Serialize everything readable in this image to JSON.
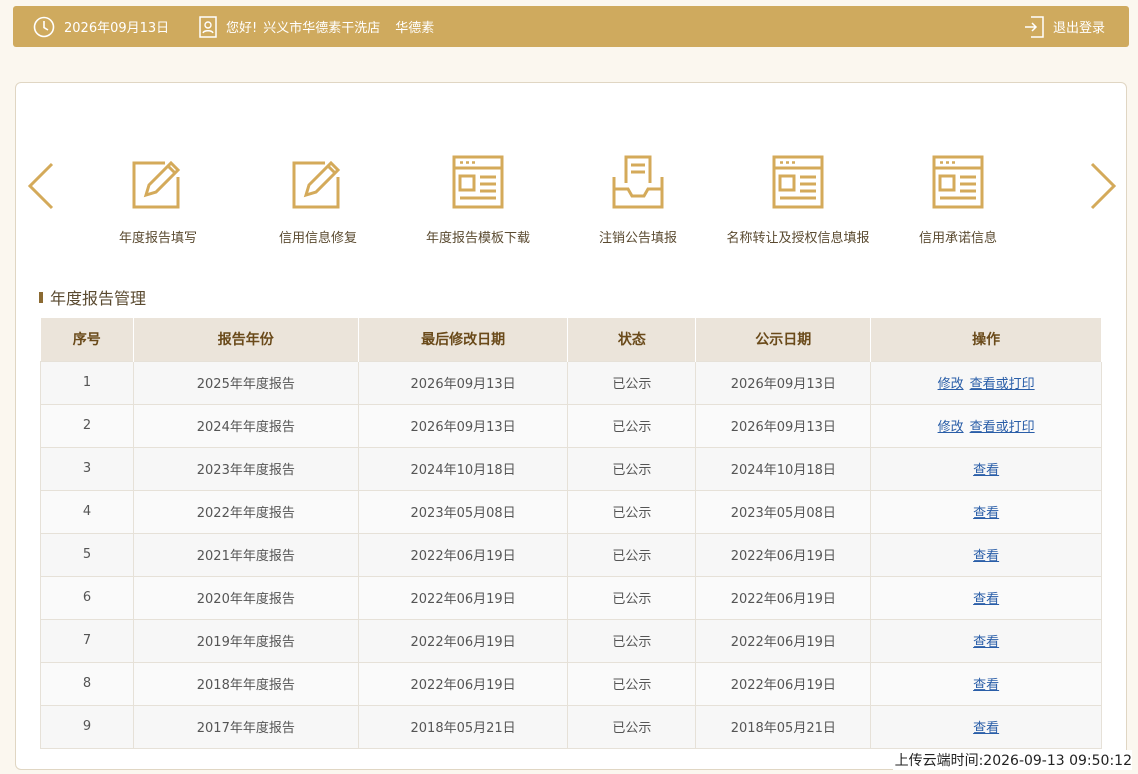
{
  "header": {
    "date": "2026年09月13日",
    "greeting": "您好!",
    "shop_name": "兴义市华德素干洗店",
    "user_name": "华德素",
    "logout_label": "退出登录"
  },
  "functions": [
    {
      "label": "年度报告填写",
      "icon": "edit-icon"
    },
    {
      "label": "信用信息修复",
      "icon": "edit-icon"
    },
    {
      "label": "年度报告模板下载",
      "icon": "document-icon"
    },
    {
      "label": "注销公告填报",
      "icon": "inbox-icon"
    },
    {
      "label": "名称转让及授权信息填报",
      "icon": "document-icon"
    },
    {
      "label": "信用承诺信息",
      "icon": "document-icon"
    }
  ],
  "section_title": "年度报告管理",
  "table": {
    "headers": [
      "序号",
      "报告年份",
      "最后修改日期",
      "状态",
      "公示日期",
      "操作"
    ],
    "rows": [
      {
        "no": "1",
        "year": "2025年年度报告",
        "modified": "2026年09月13日",
        "status": "已公示",
        "published": "2026年09月13日",
        "actions": [
          "修改",
          "查看或打印"
        ]
      },
      {
        "no": "2",
        "year": "2024年年度报告",
        "modified": "2026年09月13日",
        "status": "已公示",
        "published": "2026年09月13日",
        "actions": [
          "修改",
          "查看或打印"
        ]
      },
      {
        "no": "3",
        "year": "2023年年度报告",
        "modified": "2024年10月18日",
        "status": "已公示",
        "published": "2024年10月18日",
        "actions": [
          "查看"
        ]
      },
      {
        "no": "4",
        "year": "2022年年度报告",
        "modified": "2023年05月08日",
        "status": "已公示",
        "published": "2023年05月08日",
        "actions": [
          "查看"
        ]
      },
      {
        "no": "5",
        "year": "2021年年度报告",
        "modified": "2022年06月19日",
        "status": "已公示",
        "published": "2022年06月19日",
        "actions": [
          "查看"
        ]
      },
      {
        "no": "6",
        "year": "2020年年度报告",
        "modified": "2022年06月19日",
        "status": "已公示",
        "published": "2022年06月19日",
        "actions": [
          "查看"
        ]
      },
      {
        "no": "7",
        "year": "2019年年度报告",
        "modified": "2022年06月19日",
        "status": "已公示",
        "published": "2022年06月19日",
        "actions": [
          "查看"
        ]
      },
      {
        "no": "8",
        "year": "2018年年度报告",
        "modified": "2022年06月19日",
        "status": "已公示",
        "published": "2022年06月19日",
        "actions": [
          "查看"
        ]
      },
      {
        "no": "9",
        "year": "2017年年度报告",
        "modified": "2018年05月21日",
        "status": "已公示",
        "published": "2018年05月21日",
        "actions": [
          "查看"
        ]
      }
    ]
  },
  "upload_time": "上传云端时间:2026-09-13 09:50:12",
  "colors": {
    "accent": "#cfaa5e",
    "icon": "#d4aa5a",
    "link": "#2a5ea8"
  }
}
